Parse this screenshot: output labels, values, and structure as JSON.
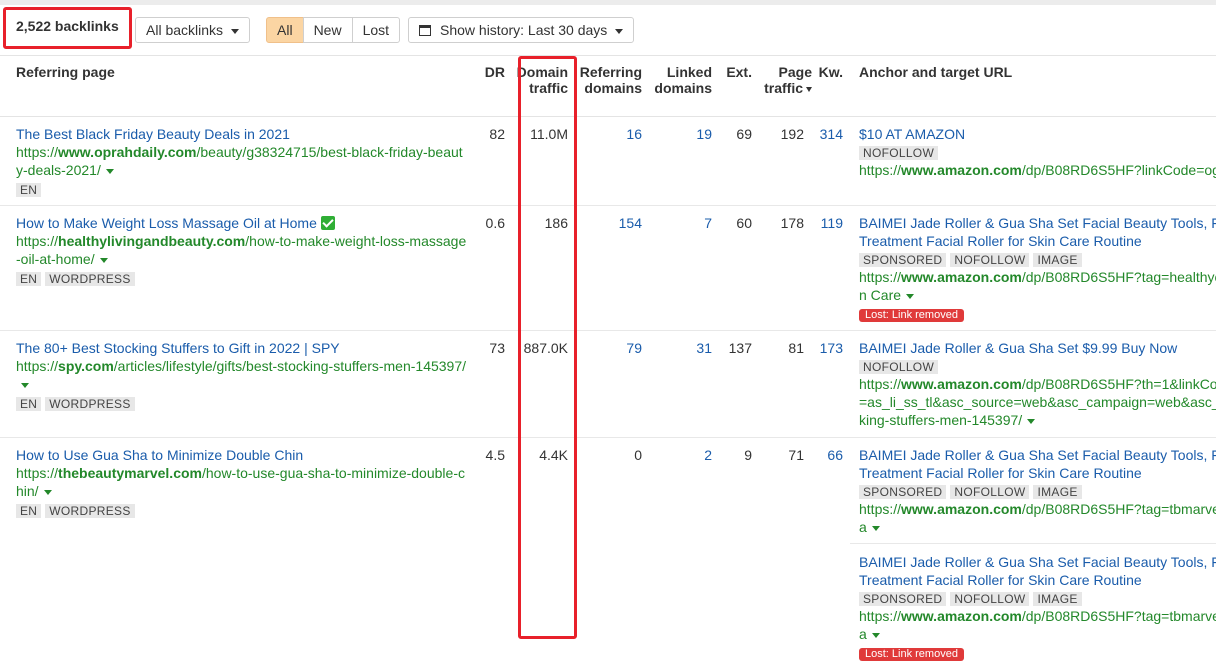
{
  "toolbar": {
    "count": "2,522 backlinks",
    "filter": "All backlinks",
    "segments": [
      "All",
      "New",
      "Lost"
    ],
    "history": "Show history: Last 30 days"
  },
  "columns": {
    "referring_page": "Referring page",
    "dr": "DR",
    "domain_traffic": [
      "Domain",
      "traffic"
    ],
    "referring_domains": [
      "Referring",
      "domains"
    ],
    "linked_domains": [
      "Linked",
      "domains"
    ],
    "ext": "Ext.",
    "page_traffic": [
      "Page",
      "traffic"
    ],
    "kw": "Kw.",
    "anchor": "Anchor and target URL"
  },
  "rows": [
    {
      "title": "The Best Black Friday Beauty Deals in 2021",
      "url_pre": "https://",
      "url_domain": "www.oprahdaily.com",
      "url_path": "/beauty/g38324715/best-black-friday-beauty-deals-2021/",
      "tags": [
        "EN"
      ],
      "dr": "82",
      "domain_traffic": "11.0M",
      "referring_domains": "16",
      "linked_domains": "19",
      "ext": "69",
      "page_traffic": "192",
      "kw": "314",
      "anchors": [
        {
          "text": "$10 AT AMAZON",
          "tags": [
            "NOFOLLOW"
          ],
          "url_pre": "https://",
          "url_domain": "www.amazon.com",
          "url_path": "/dp/B08RD6S5HF?linkCode=og"
        }
      ]
    },
    {
      "title": "How to Make Weight Loss Massage Oil at Home",
      "url_pre": "https://",
      "url_domain": "healthylivingandbeauty.com",
      "url_path": "/how-to-make-weight-loss-massage-oil-at-home/",
      "tags": [
        "EN",
        "WORDPRESS"
      ],
      "dr": "0.6",
      "domain_traffic": "186",
      "referring_domains": "154",
      "linked_domains": "7",
      "ext": "60",
      "page_traffic": "178",
      "kw": "119",
      "anchors": [
        {
          "text": "BAIMEI Jade Roller & Gua Sha Set Facial Beauty Tools, F Treatment Facial Roller for Skin Care Routine",
          "tags": [
            "SPONSORED",
            "NOFOLLOW",
            "IMAGE"
          ],
          "url_pre": "https://",
          "url_domain": "www.amazon.com",
          "url_path": "/dp/B08RD6S5HF?tag=healthyc",
          "url_cont": "n Care",
          "lost": "Lost: Link removed"
        }
      ]
    },
    {
      "title": "The 80+ Best Stocking Stuffers to Gift in 2022 | SPY",
      "url_pre": "https://",
      "url_domain": "spy.com",
      "url_path": "/articles/lifestyle/gifts/best-stocking-stuffers-men-145397/",
      "tags": [
        "EN",
        "WORDPRESS"
      ],
      "dr": "73",
      "domain_traffic": "887.0K",
      "referring_domains": "79",
      "linked_domains": "31",
      "ext": "137",
      "page_traffic": "81",
      "kw": "173",
      "anchors": [
        {
          "text": "BAIMEI Jade Roller & Gua Sha Set $9.99 Buy Now",
          "tags": [
            "NOFOLLOW"
          ],
          "url_pre": "https://",
          "url_domain": "www.amazon.com",
          "url_path": "/dp/B08RD6S5HF?th=1&linkCo",
          "url_cont": "=as_li_ss_tl&asc_source=web&asc_campaign=web&asc_",
          "url_cont2": "king-stuffers-men-145397/"
        }
      ]
    },
    {
      "title": "How to Use Gua Sha to Minimize Double Chin",
      "url_pre": "https://",
      "url_domain": "thebeautymarvel.com",
      "url_path": "/how-to-use-gua-sha-to-minimize-double-chin/",
      "tags": [
        "EN",
        "WORDPRESS"
      ],
      "dr": "4.5",
      "domain_traffic": "4.4K",
      "referring_domains": "0",
      "linked_domains": "2",
      "ext": "9",
      "page_traffic": "71",
      "kw": "66",
      "anchors": [
        {
          "text": "BAIMEI Jade Roller & Gua Sha Set Facial Beauty Tools, F Treatment Facial Roller for Skin Care Routine",
          "tags": [
            "SPONSORED",
            "NOFOLLOW",
            "IMAGE"
          ],
          "url_pre": "https://",
          "url_domain": "www.amazon.com",
          "url_path": "/dp/B08RD6S5HF?tag=tbmarve",
          "url_cont": "a"
        },
        {
          "text": "BAIMEI Jade Roller & Gua Sha Set Facial Beauty Tools, F Treatment Facial Roller for Skin Care Routine",
          "tags": [
            "SPONSORED",
            "NOFOLLOW",
            "IMAGE"
          ],
          "url_pre": "https://",
          "url_domain": "www.amazon.com",
          "url_path": "/dp/B08RD6S5HF?tag=tbmarve",
          "url_cont": "a",
          "lost": "Lost: Link removed"
        }
      ]
    }
  ],
  "colors": {
    "link": "#1a5cab",
    "url": "#23882a",
    "highlight": "#e8202a",
    "active_segment": "#fbd5a3",
    "lost": "#e03a3a"
  }
}
